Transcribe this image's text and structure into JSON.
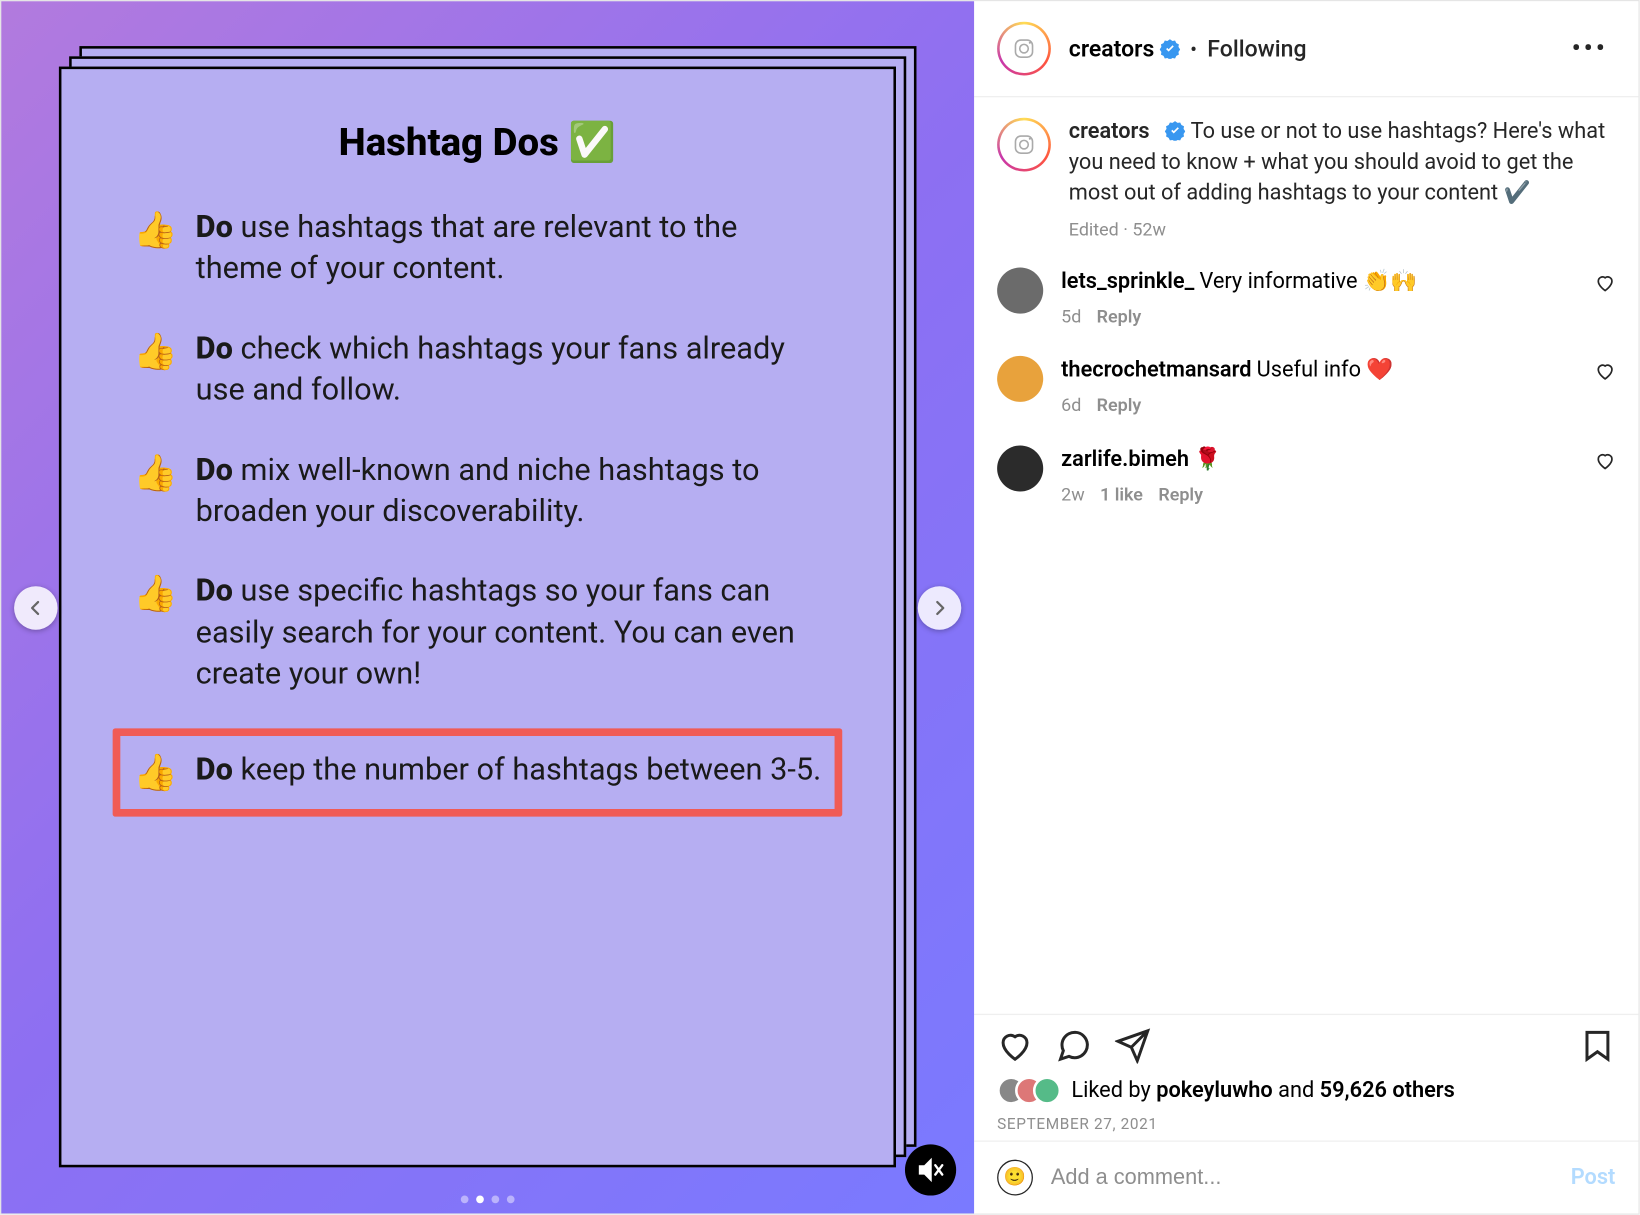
{
  "post": {
    "card_title": "Hashtag Dos ✅",
    "tips": [
      {
        "do": "Do",
        "text": " use hashtags that are relevant to the theme of your content."
      },
      {
        "do": "Do",
        "text": " check which hashtags your fans already use and follow."
      },
      {
        "do": "Do",
        "text": " mix well-known and niche hashtags to broaden your discoverability."
      },
      {
        "do": "Do",
        "text": " use specific hashtags so your fans can easily search for your content. You can even create your own!"
      },
      {
        "do": "Do",
        "text": " keep the number of hashtags between 3-5.",
        "highlight": true
      }
    ],
    "slide_index": 1,
    "slide_total": 4
  },
  "header": {
    "username": "creators",
    "separator": "•",
    "follow_state": "Following"
  },
  "caption": {
    "username": "creators",
    "text": "To use or not to use hashtags? Here's what you need to know + what you should avoid to get the most out of adding hashtags to your content ✔️",
    "edited_label": "Edited",
    "age": "52w"
  },
  "comments": [
    {
      "username": "lets_sprinkle_",
      "text": "Very informative 👏🙌",
      "age": "5d",
      "reply": "Reply",
      "avatar_bg": "#6b6b6b"
    },
    {
      "username": "thecrochetmansard",
      "text": "Useful info ❤️",
      "age": "6d",
      "reply": "Reply",
      "avatar_bg": "#e8a23c"
    },
    {
      "username": "zarlife.bimeh",
      "text": "🌹",
      "age": "2w",
      "likes": "1 like",
      "reply": "Reply",
      "avatar_bg": "#2b2b2b"
    }
  ],
  "likes": {
    "prefix": "Liked by ",
    "liker": "pokeyluwho",
    "and": " and ",
    "others": "59,626 others"
  },
  "date": "September 27, 2021",
  "add_comment": {
    "placeholder": "Add a comment...",
    "post_label": "Post"
  }
}
